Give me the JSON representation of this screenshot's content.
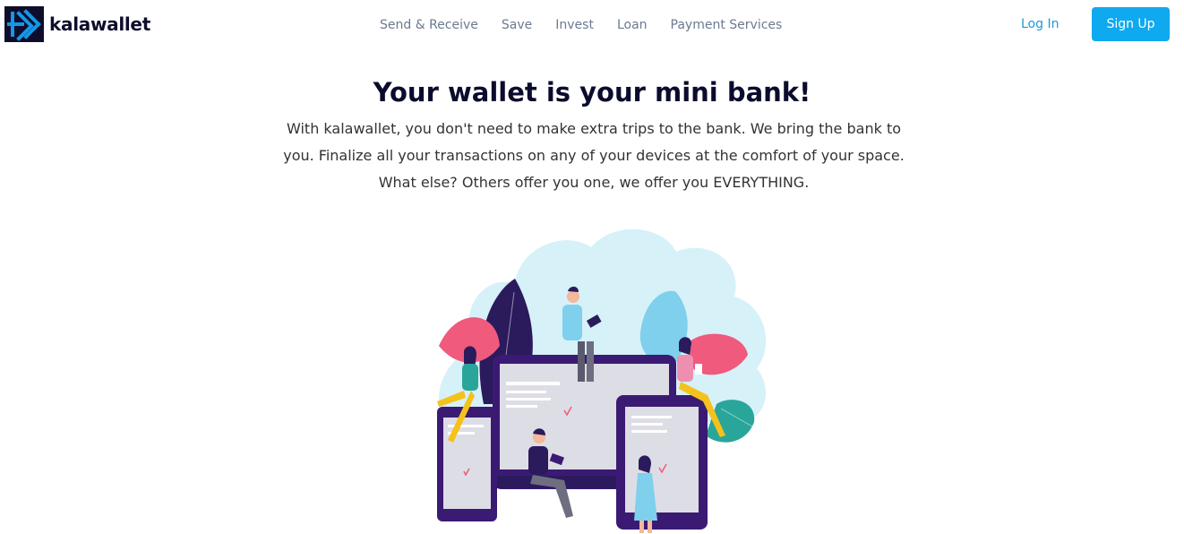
{
  "brand": {
    "name": "kalawallet"
  },
  "nav": {
    "links": [
      "Send & Receive",
      "Save",
      "Invest",
      "Loan",
      "Payment Services"
    ]
  },
  "auth": {
    "login_label": "Log In",
    "signup_label": "Sign Up"
  },
  "hero": {
    "title": "Your wallet is your mini bank!",
    "text": "With kalawallet, you don't need to make extra trips to the bank. We bring the bank to you. Finalize all your transactions on any of your devices at the comfort of your space. What else? Others offer you one, we offer you EVERYTHING."
  },
  "colors": {
    "brand_dark": "#0e0e2c",
    "logo_accent": "#1597e5",
    "nav_text": "#6b7a90",
    "link_blue": "#1a9ad9",
    "button_blue": "#0fa9ef",
    "title_dark": "#0b0b2e",
    "illustration_sky": "#d6f1f8",
    "illustration_purple": "#3b1a73",
    "illustration_pink": "#ef5a7d",
    "illustration_teal": "#2aa59a"
  },
  "icons": [
    "kalawallet-logo-icon",
    "hero-illustration"
  ]
}
